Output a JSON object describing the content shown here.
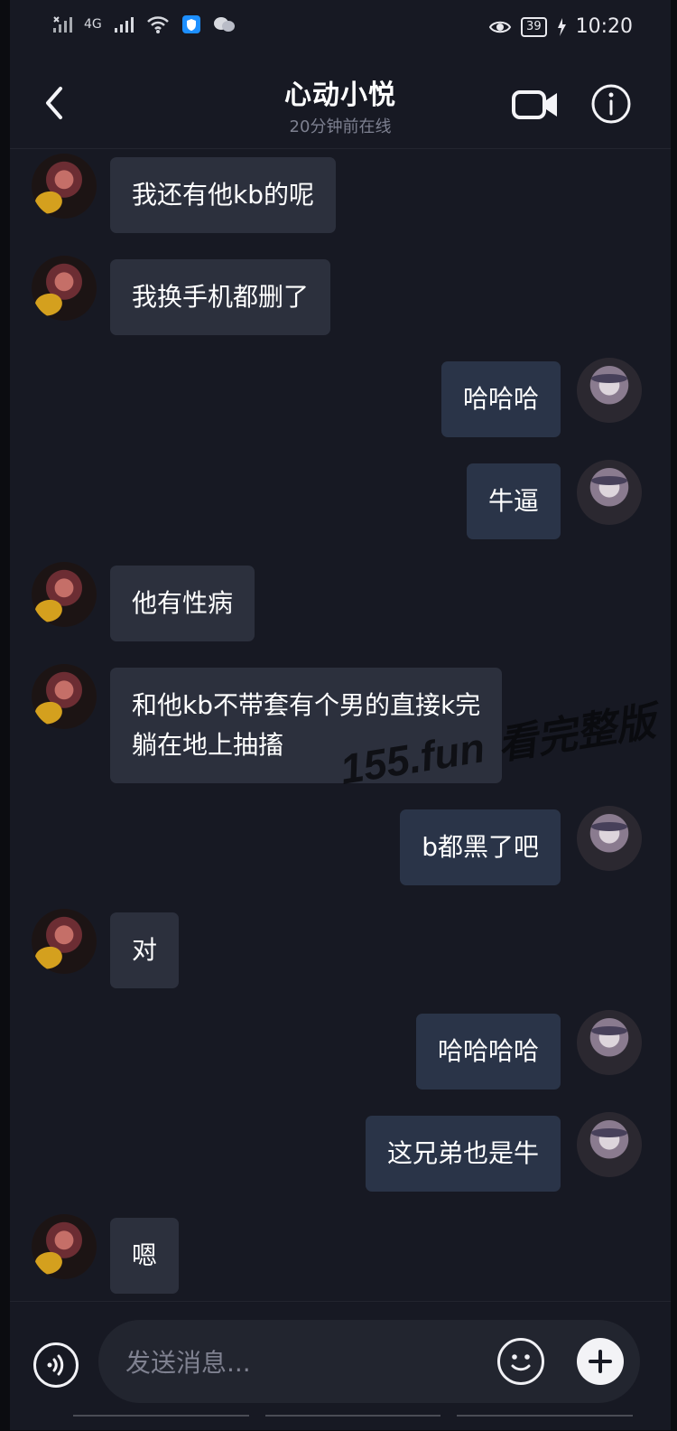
{
  "status": {
    "network": "4G",
    "battery": "39",
    "time": "10:20"
  },
  "header": {
    "back_icon": "chevron-left-icon",
    "title": "心动小悦",
    "subtitle": "20分钟前在线",
    "video_icon": "video-camera-icon",
    "info_icon": "info-icon"
  },
  "messages": [
    {
      "side": "left",
      "text": "我还有他kb的呢"
    },
    {
      "side": "left",
      "text": "我换手机都删了"
    },
    {
      "side": "right",
      "text": "哈哈哈"
    },
    {
      "side": "right",
      "text": "牛逼"
    },
    {
      "side": "left",
      "text": "他有性病"
    },
    {
      "side": "left",
      "text": "和他kb不带套有个男的直接k完\n躺在地上抽搐"
    },
    {
      "side": "right",
      "text": "b都黑了吧"
    },
    {
      "side": "left",
      "text": "对"
    },
    {
      "side": "right",
      "text": "哈哈哈哈"
    },
    {
      "side": "right",
      "text": "这兄弟也是牛"
    },
    {
      "side": "left",
      "text": "嗯"
    }
  ],
  "watermark": {
    "site": "155.fun",
    "label": "看完整版"
  },
  "composer": {
    "placeholder": "发送消息...",
    "voice_icon": "voice-icon",
    "emoji_icon": "emoji-icon",
    "plus_icon": "plus-icon"
  },
  "colors": {
    "background": "#171923",
    "incoming_bubble": "#2c303d",
    "outgoing_bubble": "#2a3448",
    "secondary_text": "#7d8090"
  }
}
